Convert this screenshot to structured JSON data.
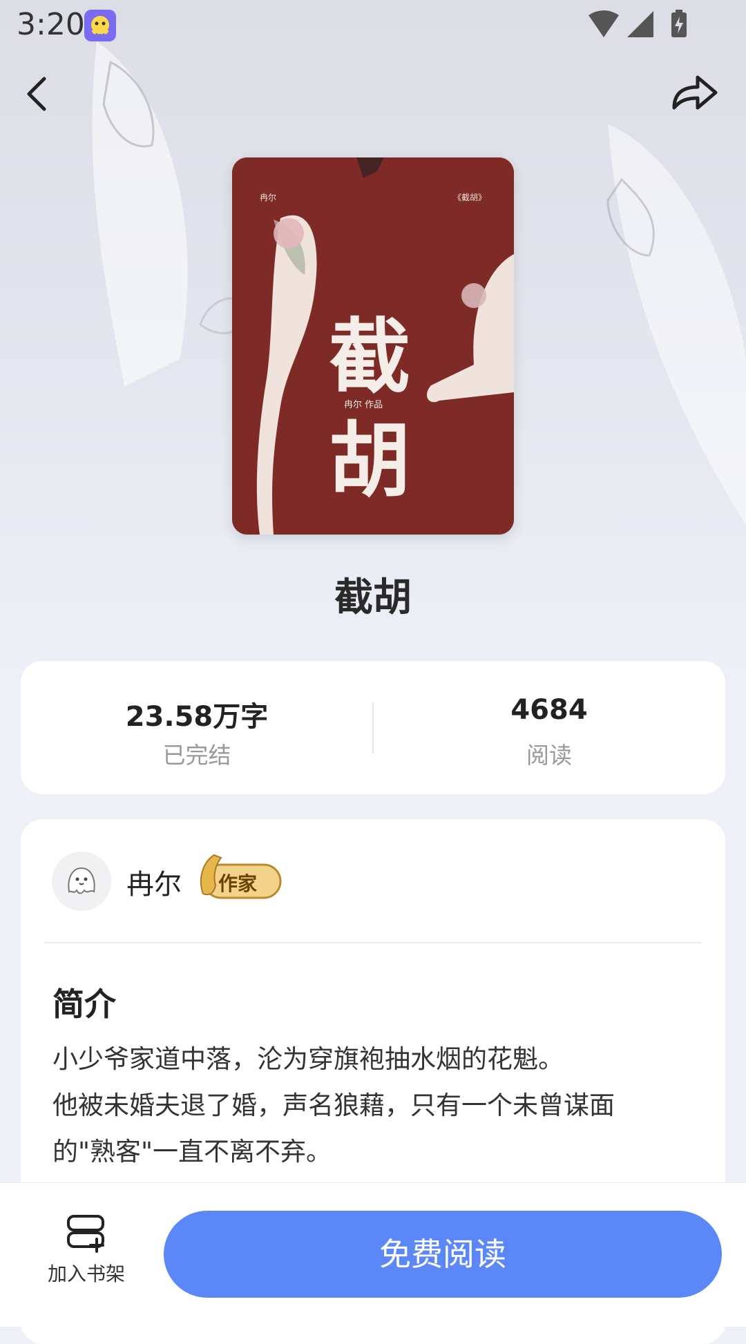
{
  "status_bar": {
    "time": "3:20"
  },
  "book": {
    "title": "截胡",
    "cover": {
      "author_small": "冉尔",
      "title_tag": "《截胡》",
      "big_char_1": "截",
      "big_char_2": "胡",
      "credit": "冉尔 作品"
    }
  },
  "stats": {
    "word_count": "23.58万字",
    "status": "已完结",
    "reads": "4684",
    "reads_label": "阅读"
  },
  "author": {
    "name": "冉尔",
    "badge": "作家"
  },
  "intro": {
    "heading": "简介",
    "lines": [
      "小少爷家道中落，沦为穿旗袍抽水烟的花魁。",
      "他被未婚夫退了婚，声名狼藉，只有一个未曾谋面",
      "的\"熟客\"一直不离不弃。"
    ]
  },
  "bottom": {
    "shelf_label": "加入书架",
    "read_button": "免费阅读"
  },
  "colors": {
    "accent": "#5b87f8",
    "cover": "#7e2a27"
  }
}
